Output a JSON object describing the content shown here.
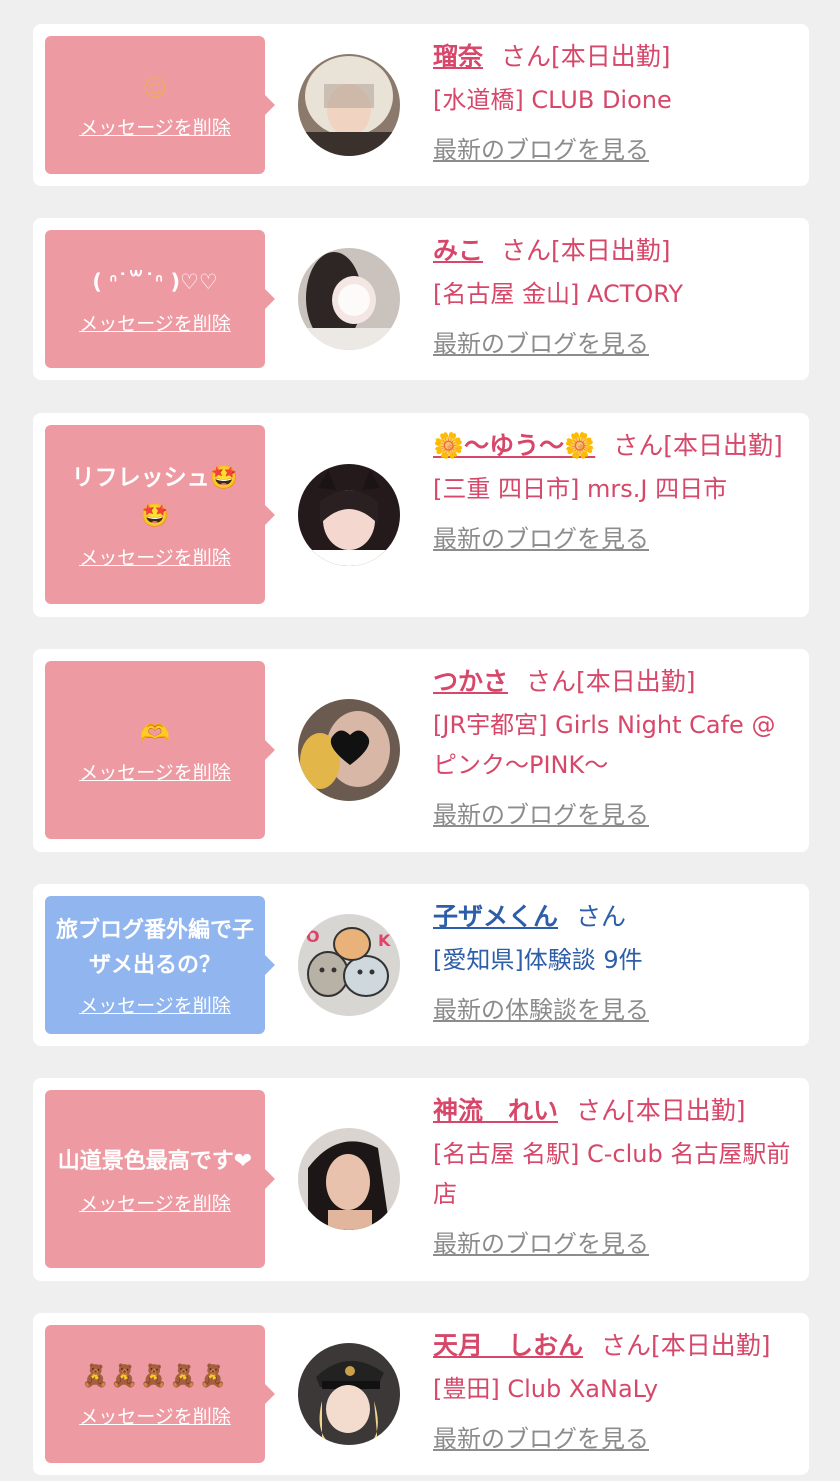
{
  "delete_label": "メッセージを削除",
  "colors": {
    "page_bg": "#efefef",
    "card_bg": "#ffffff",
    "bubble_pink": "#ee9aa3",
    "bubble_blue": "#90b5ef",
    "name_pink": "#d64769",
    "name_blue": "#2e5ea8",
    "link_gray": "#8c8c8c"
  },
  "items": [
    {
      "message": "☺",
      "name": "瑠奈",
      "suffix": "さん[本日出勤]",
      "shop": "[水道橋] CLUB Dione",
      "link": "最新のブログを見る",
      "avatar_icon": "girl-photo"
    },
    {
      "message": "( ᐢ˙꒳˙ᐢ )♡♡",
      "name": "みこ",
      "suffix": "さん[本日出勤]",
      "shop": "[名古屋 金山] ACTORY",
      "link": "最新のブログを見る",
      "avatar_icon": "girl-photo"
    },
    {
      "message": "リフレッシュ🤩🤩",
      "name": "🌼〜ゆう〜🌼",
      "suffix": "さん[本日出勤]",
      "shop": "[三重 四日市] mrs.J 四日市",
      "link": "最新のブログを見る",
      "avatar_icon": "girl-photo-cat-ears"
    },
    {
      "message": "🫶",
      "name": "つかさ",
      "suffix": "さん[本日出勤]",
      "shop": "[JR宇都宮] Girls Night Cafe @ピンク〜PINK〜",
      "link": "最新のブログを見る",
      "avatar_icon": "girl-photo-heart"
    },
    {
      "message": "旅ブログ番外編で子ザメ出るの？",
      "name": "子ザメくん",
      "suffix": "さん",
      "shop": "[愛知県]体験談 9件",
      "link": "最新の体験談を見る",
      "avatar_icon": "shark-mascot"
    },
    {
      "message": "山道景色最高です❤",
      "name": "神流　れい",
      "suffix": "さん[本日出勤]",
      "shop": "[名古屋 名駅] C-club 名古屋駅前店",
      "link": "最新のブログを見る",
      "avatar_icon": "girl-photo"
    },
    {
      "message": "🧸🧸🧸🧸🧸",
      "name": "天月　しおん",
      "suffix": "さん[本日出勤]",
      "shop": "[豊田] Club XaNaLy",
      "link": "最新のブログを見る",
      "avatar_icon": "girl-photo-police-cap"
    }
  ]
}
